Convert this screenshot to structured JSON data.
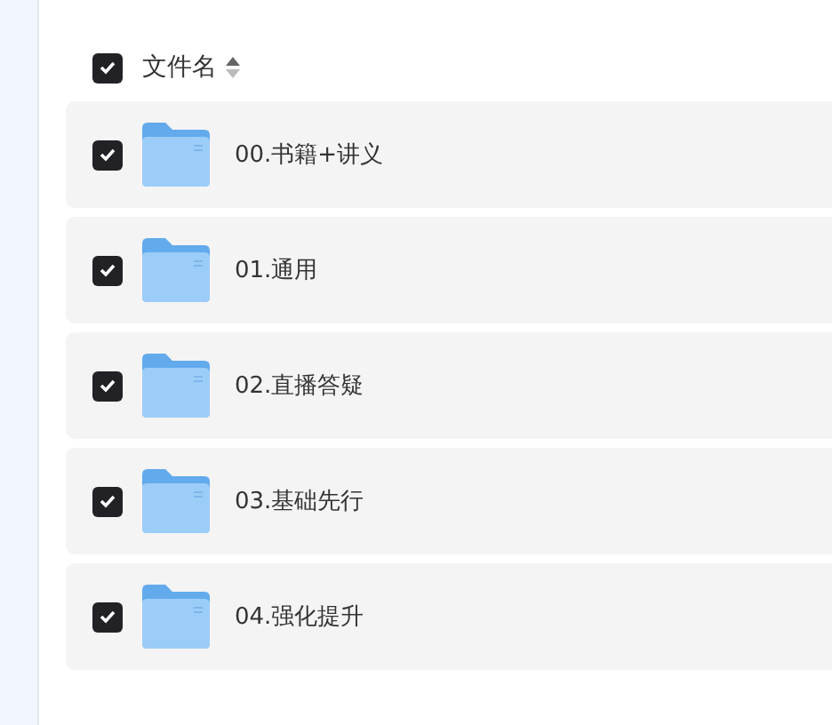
{
  "header": {
    "checked": true,
    "label": "文件名"
  },
  "files": [
    {
      "name": "00.书籍+讲义",
      "checked": true
    },
    {
      "name": "01.通用",
      "checked": true
    },
    {
      "name": "02.直播答疑",
      "checked": true
    },
    {
      "name": "03.基础先行",
      "checked": true
    },
    {
      "name": "04.强化提升",
      "checked": true
    }
  ]
}
